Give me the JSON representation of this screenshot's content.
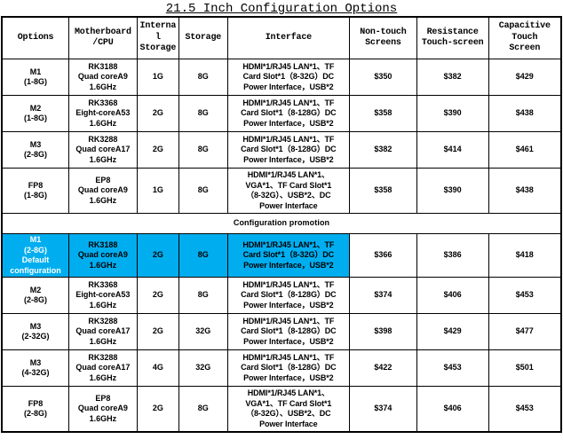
{
  "title": "21.5 Inch Configuration Options",
  "table": {
    "headers": [
      "Options",
      "Motherboard\n/CPU",
      "Internal Storage",
      "Storage",
      "Interface",
      "Non-touch Screens",
      "Resistance Touch-screen",
      "Capacitive Touch Screen"
    ],
    "header_parts": {
      "options": "Options",
      "motherboard_l1": "Motherboard",
      "motherboard_l2": "/CPU",
      "internal_l1": "Internal",
      "internal_l2": "Storage",
      "storage": "Storage",
      "interface": "Interface",
      "nontouch_l1": "Non-touch",
      "nontouch_l2": "Screens",
      "resistance_l1": "Resistance",
      "resistance_l2": "Touch-screen",
      "capacitive_l1": "Capacitive",
      "capacitive_l2": "Touch",
      "capacitive_l3": "Screen"
    },
    "promotion_divider_label": "Configuration promotion",
    "highlight_color": "#00AEEF",
    "rows": [
      {
        "option_model": "M1",
        "option_spec": "(1-8G)",
        "cpu_l1": "RK3188",
        "cpu_l2": "Quad coreA9",
        "cpu_l3": "1.6GHz",
        "internal_storage": "1G",
        "storage": "8G",
        "interface_l1": "HDMI*1/RJ45 LAN*1、TF",
        "interface_l2": "Card Slot*1（8-32G）DC",
        "interface_l3": "Power Interface，USB*2",
        "interface_l4": "",
        "non_touch_price": "$350",
        "resistance_price": "$382",
        "capacitive_price": "$429",
        "highlighted": false,
        "default_label": ""
      },
      {
        "option_model": "M2",
        "option_spec": "(1-8G)",
        "cpu_l1": "RK3368",
        "cpu_l2": "Eight-coreA53",
        "cpu_l3": "1.6GHz",
        "internal_storage": "2G",
        "storage": "8G",
        "interface_l1": "HDMI*1/RJ45 LAN*1、TF",
        "interface_l2": "Card Slot*1（8-128G）DC",
        "interface_l3": "Power Interface，USB*2",
        "interface_l4": "",
        "non_touch_price": "$358",
        "resistance_price": "$390",
        "capacitive_price": "$438",
        "highlighted": false,
        "default_label": ""
      },
      {
        "option_model": "M3",
        "option_spec": "(2-8G)",
        "cpu_l1": "RK3288",
        "cpu_l2": "Quad coreA17",
        "cpu_l3": "1.6GHz",
        "internal_storage": "2G",
        "storage": "8G",
        "interface_l1": "HDMI*1/RJ45 LAN*1、TF",
        "interface_l2": "Card Slot*1（8-128G）DC",
        "interface_l3": "Power Interface，USB*2",
        "interface_l4": "",
        "non_touch_price": "$382",
        "resistance_price": "$414",
        "capacitive_price": "$461",
        "highlighted": false,
        "default_label": ""
      },
      {
        "option_model": "FP8",
        "option_spec": "(1-8G)",
        "cpu_l1": "EP8",
        "cpu_l2": "Quad coreA9",
        "cpu_l3": "1.6GHz",
        "internal_storage": "1G",
        "storage": "8G",
        "interface_l1": "HDMI*1/RJ45 LAN*1、",
        "interface_l2": "VGA*1、TF Card Slot*1",
        "interface_l3": "（8-32G）、USB*2、DC",
        "interface_l4": "Power Interface",
        "non_touch_price": "$358",
        "resistance_price": "$390",
        "capacitive_price": "$438",
        "highlighted": false,
        "default_label": ""
      },
      {
        "option_model": "M1",
        "option_spec": "(2-8G)",
        "cpu_l1": "RK3188",
        "cpu_l2": "Quad coreA9",
        "cpu_l3": "1.6GHz",
        "internal_storage": "2G",
        "storage": "8G",
        "interface_l1": "HDMI*1/RJ45 LAN*1、TF",
        "interface_l2": "Card Slot*1（8-32G）DC",
        "interface_l3": "Power Interface，USB*2",
        "interface_l4": "",
        "non_touch_price": "$366",
        "resistance_price": "$386",
        "capacitive_price": "$418",
        "highlighted": true,
        "default_label": "Default configuration"
      },
      {
        "option_model": "M2",
        "option_spec": "(2-8G)",
        "cpu_l1": "RK3368",
        "cpu_l2": "Eight-coreA53",
        "cpu_l3": "1.6GHz",
        "internal_storage": "2G",
        "storage": "8G",
        "interface_l1": "HDMI*1/RJ45 LAN*1、TF",
        "interface_l2": "Card Slot*1（8-128G）DC",
        "interface_l3": "Power Interface，USB*2",
        "interface_l4": "",
        "non_touch_price": "$374",
        "resistance_price": "$406",
        "capacitive_price": "$453",
        "highlighted": false,
        "default_label": ""
      },
      {
        "option_model": "M3",
        "option_spec": "(2-32G)",
        "cpu_l1": "RK3288",
        "cpu_l2": "Quad coreA17",
        "cpu_l3": "1.6GHz",
        "internal_storage": "2G",
        "storage": "32G",
        "interface_l1": "HDMI*1/RJ45 LAN*1、TF",
        "interface_l2": "Card Slot*1（8-128G）DC",
        "interface_l3": "Power Interface，USB*2",
        "interface_l4": "",
        "non_touch_price": "$398",
        "resistance_price": "$429",
        "capacitive_price": "$477",
        "highlighted": false,
        "default_label": ""
      },
      {
        "option_model": "M3",
        "option_spec": "(4-32G)",
        "cpu_l1": "RK3288",
        "cpu_l2": "Quad coreA17",
        "cpu_l3": "1.6GHz",
        "internal_storage": "4G",
        "storage": "32G",
        "interface_l1": "HDMI*1/RJ45 LAN*1、TF",
        "interface_l2": "Card Slot*1（8-128G）DC",
        "interface_l3": "Power Interface，USB*2",
        "interface_l4": "",
        "non_touch_price": "$422",
        "resistance_price": "$453",
        "capacitive_price": "$501",
        "highlighted": false,
        "default_label": ""
      },
      {
        "option_model": "FP8",
        "option_spec": "(2-8G)",
        "cpu_l1": "EP8",
        "cpu_l2": "Quad coreA9",
        "cpu_l3": "1.6GHz",
        "internal_storage": "2G",
        "storage": "8G",
        "interface_l1": "HDMI*1/RJ45 LAN*1、",
        "interface_l2": "VGA*1、TF Card Slot*1",
        "interface_l3": "（8-32G）、USB*2、DC",
        "interface_l4": "Power Interface",
        "non_touch_price": "$374",
        "resistance_price": "$406",
        "capacitive_price": "$453",
        "highlighted": false,
        "default_label": ""
      }
    ]
  }
}
